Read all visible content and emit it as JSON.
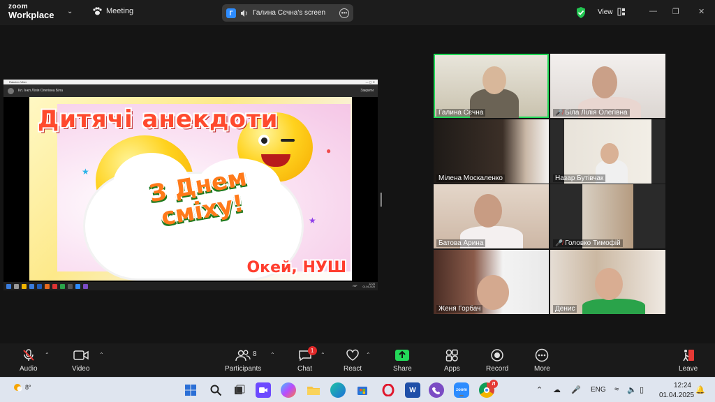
{
  "app": {
    "brand_top": "zoom",
    "brand_bottom": "Workplace",
    "meeting_label": "Meeting",
    "view_label": "View"
  },
  "share_pill": {
    "avatar_letter": "Г",
    "title": "Галина Сєчна's screen"
  },
  "shared_screen": {
    "window_title": "Rakuten Viber",
    "chat_name": "Кл. Інкл Лілія Олегівна Біла",
    "close_label": "Закрити",
    "slide_title": "Дитячі анекдоти",
    "slide_center_line1": "З Днем",
    "slide_center_line2": "сміху!",
    "slide_footer": "Окей, НУШ",
    "task_lang": "УКР",
    "task_time": "12:24",
    "task_date": "01.04.2025"
  },
  "participants": [
    {
      "name": "Галина Сєчна",
      "muted": false,
      "active": true
    },
    {
      "name": "Біла Лілія Олегівна",
      "muted": true,
      "active": false
    },
    {
      "name": "Мілена Москаленко",
      "muted": false,
      "active": false
    },
    {
      "name": "Назар Бутівчак",
      "muted": false,
      "active": false
    },
    {
      "name": "Батова Арина",
      "muted": false,
      "active": false
    },
    {
      "name": "Головко Тимофій",
      "muted": true,
      "active": false
    },
    {
      "name": "Женя Горбач",
      "muted": false,
      "active": false
    },
    {
      "name": "Денис",
      "muted": false,
      "active": false
    }
  ],
  "toolbar": {
    "audio": "Audio",
    "video": "Video",
    "participants": "Participants",
    "participants_count": "8",
    "chat": "Chat",
    "chat_badge": "1",
    "react": "React",
    "share": "Share",
    "apps": "Apps",
    "record": "Record",
    "more": "More",
    "leave": "Leave"
  },
  "taskbar": {
    "weather_temp": "8°",
    "lang": "ENG",
    "time": "12:24",
    "date": "01.04.2025",
    "word_letter": "W",
    "chrome_badge": "Л"
  },
  "colors": {
    "zoom_blue": "#2d8cff",
    "active_green": "#23d959",
    "share_green": "#23d959",
    "badge_red": "#e02828"
  }
}
